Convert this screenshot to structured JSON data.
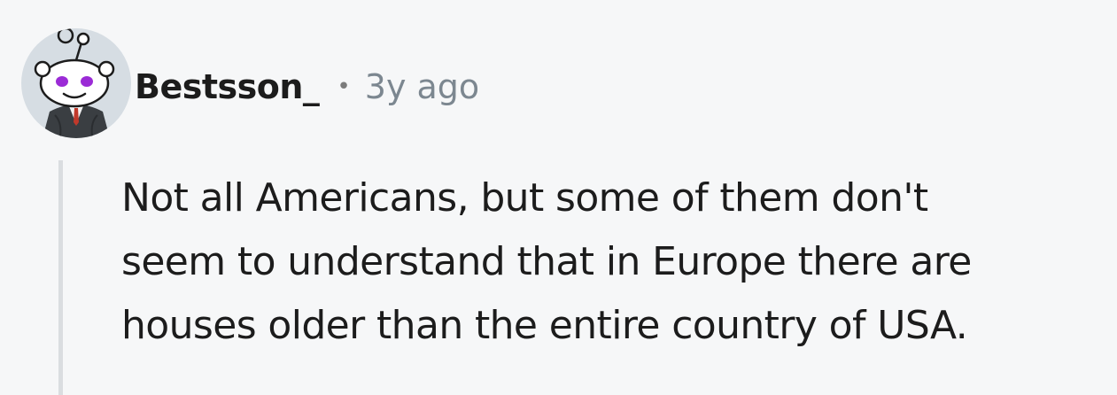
{
  "comment": {
    "author": "Bestsson_",
    "separator": "•",
    "timestamp": "3y ago",
    "body_lines": [
      "Not all Americans, but some of them don't",
      "seem to understand that in Europe there are",
      "houses older than the entire country of USA."
    ]
  },
  "icons": {
    "avatar": "snoo-avatar-icon"
  },
  "colors": {
    "background": "#f6f7f8",
    "text": "#1c1c1c",
    "meta": "#7c8790",
    "thread_line": "#dadde0",
    "avatar_eyes": "#9b2bd6"
  }
}
